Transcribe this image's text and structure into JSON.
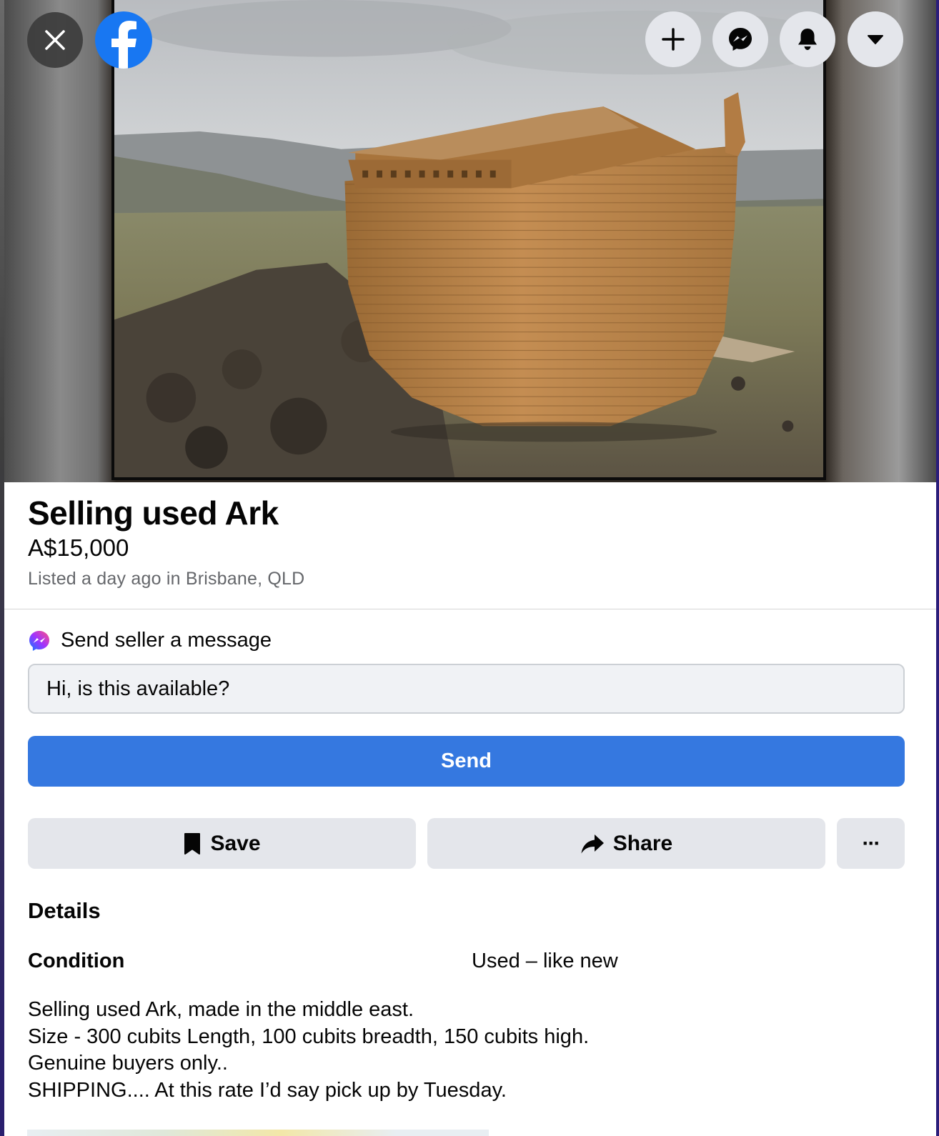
{
  "topbar": {
    "close_icon": "close-icon",
    "logo_icon": "facebook-logo",
    "actions": [
      {
        "name": "create-button",
        "icon": "plus-icon"
      },
      {
        "name": "messenger-button",
        "icon": "messenger-icon"
      },
      {
        "name": "notifications-button",
        "icon": "bell-icon"
      },
      {
        "name": "account-menu-button",
        "icon": "caret-down-icon"
      }
    ]
  },
  "listing": {
    "title": "Selling used Ark",
    "price": "A$15,000",
    "listed": "Listed a day ago in Brisbane, QLD"
  },
  "message": {
    "label": "Send seller a message",
    "input_value": "Hi, is this available?",
    "send_label": "Send"
  },
  "actions": {
    "save_label": "Save",
    "share_label": "Share",
    "more_label": "···"
  },
  "details": {
    "heading": "Details",
    "condition_label": "Condition",
    "condition_value": "Used – like new",
    "description": [
      "Selling used Ark, made in the middle east.",
      "Size - 300 cubits Length, 100 cubits breadth, 150 cubits high.",
      "Genuine buyers only..",
      "SHIPPING.... At this rate I’d say pick up by Tuesday."
    ]
  },
  "colors": {
    "send_button": "#3578e0",
    "facebook_blue": "#1877f2",
    "secondary_button": "#e4e6eb",
    "muted_text": "#65676b"
  }
}
